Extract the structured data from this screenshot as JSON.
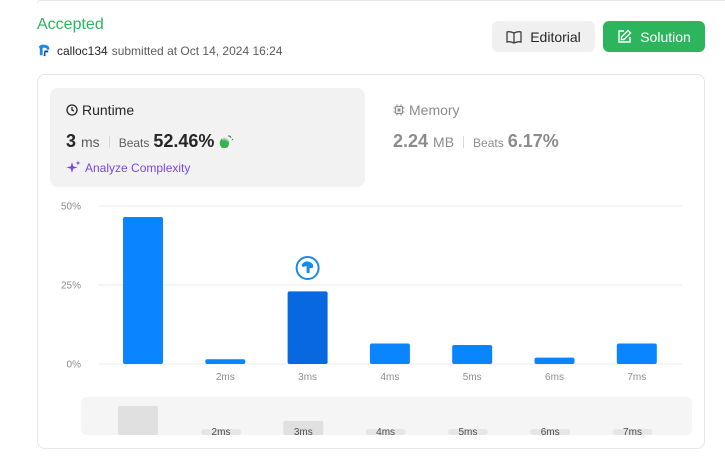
{
  "status": "Accepted",
  "submitter": {
    "username": "calloc134",
    "submitted_text": "submitted at Oct 14, 2024 16:24"
  },
  "buttons": {
    "editorial": "Editorial",
    "solution": "Solution"
  },
  "runtime": {
    "title": "Runtime",
    "value": "3",
    "unit": "ms",
    "beats_label": "Beats",
    "beats_value": "52.46%",
    "analyze_label": "Analyze Complexity"
  },
  "memory": {
    "title": "Memory",
    "value": "2.24",
    "unit": "MB",
    "beats_label": "Beats",
    "beats_value": "6.17%"
  },
  "colors": {
    "accent_green": "#2db55d",
    "bar_blue": "#0a84ff",
    "bar_selected": "#0768e0",
    "purple": "#7a48e8"
  },
  "chart_data": {
    "type": "bar",
    "categories": [
      "",
      "2ms",
      "3ms",
      "4ms",
      "5ms",
      "6ms",
      "7ms"
    ],
    "values": [
      46.5,
      1.5,
      23,
      6.5,
      6,
      2,
      6.5
    ],
    "selected_index": 2,
    "y_ticks": [
      "50%",
      "25%",
      "0%"
    ],
    "ylim": [
      0,
      50
    ],
    "grid": true
  },
  "scroller": {
    "labels": [
      "2ms",
      "3ms",
      "4ms",
      "5ms",
      "6ms",
      "7ms"
    ]
  }
}
